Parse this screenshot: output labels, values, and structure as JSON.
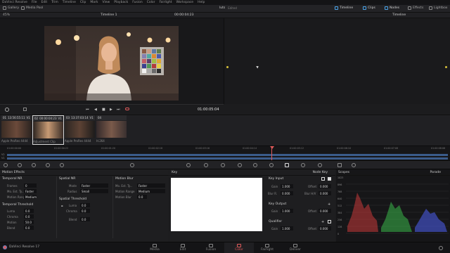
{
  "menubar": {
    "items": [
      "DaVinci Resolve",
      "File",
      "Edit",
      "Trim",
      "Timeline",
      "Clip",
      "Mark",
      "View",
      "Playback",
      "Fusion",
      "Color",
      "Fairlight",
      "Workspace",
      "Help"
    ]
  },
  "toolbar": {
    "gallery": "Gallery",
    "media_pool": "Media Pool",
    "project_name": "luts",
    "edited": "Edited",
    "timeline": "Timeline",
    "clips": "Clips",
    "nodes": "Nodes",
    "effects": "Effects",
    "lightbox": "Lightbox"
  },
  "viewer": {
    "zoom": "45%",
    "timeline_name": "Timeline 1",
    "timecode_top": "00:00:04:23",
    "timecode": "01:00:05:04",
    "node_view_name": "Timeline"
  },
  "clips": [
    {
      "num": "01",
      "tc": "13:56:55:11",
      "track": "V1",
      "name": "Apple ProRes 4444",
      "colors": [
        "#3a2c24",
        "#6b4a3a",
        "#2a2320"
      ]
    },
    {
      "num": "02",
      "tc": "00:00:04:23",
      "track": "V1",
      "name": "Adjustment Clip",
      "colors": [
        "#2c2420",
        "#c79a74",
        "#3b2e28"
      ]
    },
    {
      "num": "03",
      "tc": "13:37:03:14",
      "track": "V1",
      "name": "Apple ProRes 4444",
      "colors": [
        "#2a2522",
        "#5c4234",
        "#1e1c1b"
      ]
    },
    {
      "num": "04",
      "tc": "",
      "track": "",
      "name": "H.264",
      "colors": [
        "#33292a",
        "#7a5a4a",
        "#3a3030"
      ]
    }
  ],
  "mini_timeline": {
    "ticks": [
      "01:00:00:00",
      "01:00:00:22",
      "01:00:01:20",
      "01:00:02:18",
      "01:00:03:16",
      "01:00:04:14",
      "01:00:05:12",
      "01:00:06:10",
      "01:00:07:08",
      "01:00:08:06"
    ],
    "tracks": [
      "V2",
      "V1"
    ]
  },
  "motion_effects": {
    "title": "Motion Effects",
    "temporal_nr": "Temporal NR",
    "frames_label": "Frames",
    "frames_value": "0",
    "mo_est_label": "Mo. Est. Ty...",
    "mo_est_value": "Faster",
    "motion_range_label": "Motion Range",
    "motion_range_value": "Medium",
    "temporal_threshold": "Temporal Threshold",
    "luma_label": "Luma",
    "luma_value": "0.0",
    "chroma_label": "Chroma",
    "chroma_value": "0.0",
    "motion_label": "Motion",
    "motion_value": "50.0",
    "blend_label": "Blend",
    "blend_value": "0.0",
    "spatial_nr": "Spatial NR",
    "mode_label": "Mode",
    "mode_value": "Faster",
    "radius_label": "Radius",
    "radius_value": "Small",
    "spatial_threshold": "Spatial Threshold",
    "sp_luma_value": "0.0",
    "sp_chroma_value": "0.0",
    "sp_blend_value": "0.0",
    "motion_blur": "Motion Blur",
    "mb_mo_est_value": "Faster",
    "mb_range_label": "Motion Range",
    "mb_range_value": "Medium",
    "mb_blur_label": "Motion Blur",
    "mb_blur_value": "0.0"
  },
  "key": {
    "title": "Key",
    "node_key": "Node Key",
    "key_input": "Key Input",
    "gain_label": "Gain",
    "gain_value": "1.000",
    "blur_r_label": "Blur R.",
    "blur_r_value": "0.000",
    "blur_hv_label": "Blur H/V",
    "blur_hv_value": "0.000",
    "offset_label": "Offset",
    "offset_value": "0.000",
    "key_output": "Key Output",
    "ko_gain_value": "1.000",
    "ko_offset_value": "0.000",
    "qualifier": "Qualifier",
    "q_gain_value": "1.000",
    "q_offset_value": "0.000"
  },
  "scopes": {
    "title": "Scopes",
    "mode": "Parade",
    "scale": [
      "1023",
      "896",
      "768",
      "640",
      "512",
      "384",
      "256",
      "128",
      "0"
    ]
  },
  "pages": [
    "Media",
    "Cut",
    "Edit",
    "Fusion",
    "Color",
    "Fairlight",
    "Deliver"
  ],
  "active_page": "Color",
  "app_label": "DaVinci Resolve 17",
  "colors": {
    "accent": "#e05a5a",
    "background": "#1c1c1e"
  }
}
